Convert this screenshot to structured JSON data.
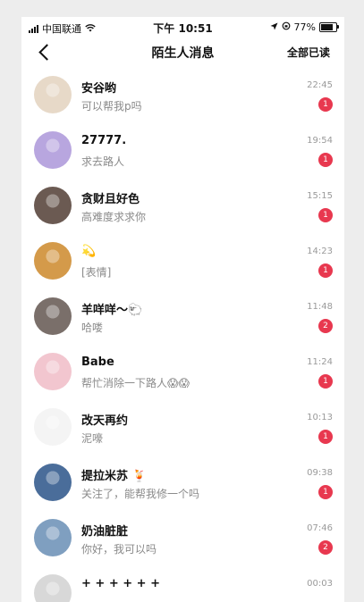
{
  "status": {
    "carrier": "中国联通",
    "time": "下午 10:51",
    "battery": "77%"
  },
  "nav": {
    "title": "陌生人消息",
    "read_all": "全部已读"
  },
  "conversations": [
    {
      "name": "安谷哟",
      "message": "可以帮我p吗",
      "time": "22:45",
      "unread": "1",
      "avatar_color": "#e7d9c8"
    },
    {
      "name": "27777.",
      "message": "求去路人",
      "time": "19:54",
      "unread": "1",
      "avatar_color": "#b8a6df"
    },
    {
      "name": "贪财且好色",
      "message": "高难度求求你",
      "time": "15:15",
      "unread": "1",
      "avatar_color": "#6b5a52"
    },
    {
      "name": "💫",
      "message": "[表情]",
      "time": "14:23",
      "unread": "1",
      "avatar_color": "#d49a4a"
    },
    {
      "name": "羊咩咩～🐑",
      "message": "哈喽",
      "time": "11:48",
      "unread": "2",
      "avatar_color": "#7a6f6a"
    },
    {
      "name": "Babe",
      "message": "帮忙消除一下路人😱😱",
      "time": "11:24",
      "unread": "1",
      "avatar_color": "#f2c6cf"
    },
    {
      "name": "改天再约",
      "message": "泥嚎",
      "time": "10:13",
      "unread": "1",
      "avatar_color": "#f4f4f4"
    },
    {
      "name": "提拉米苏 🍹",
      "message": "关注了，能帮我修一个吗",
      "time": "09:38",
      "unread": "1",
      "avatar_color": "#4a6d9a"
    },
    {
      "name": "奶油脏脏",
      "message": "你好，我可以吗",
      "time": "07:46",
      "unread": "2",
      "avatar_color": "#7f9fc0"
    },
    {
      "name": "+ + + + + +",
      "message": "",
      "time": "00:03",
      "unread": "",
      "avatar_color": "#d8d8d8"
    }
  ]
}
